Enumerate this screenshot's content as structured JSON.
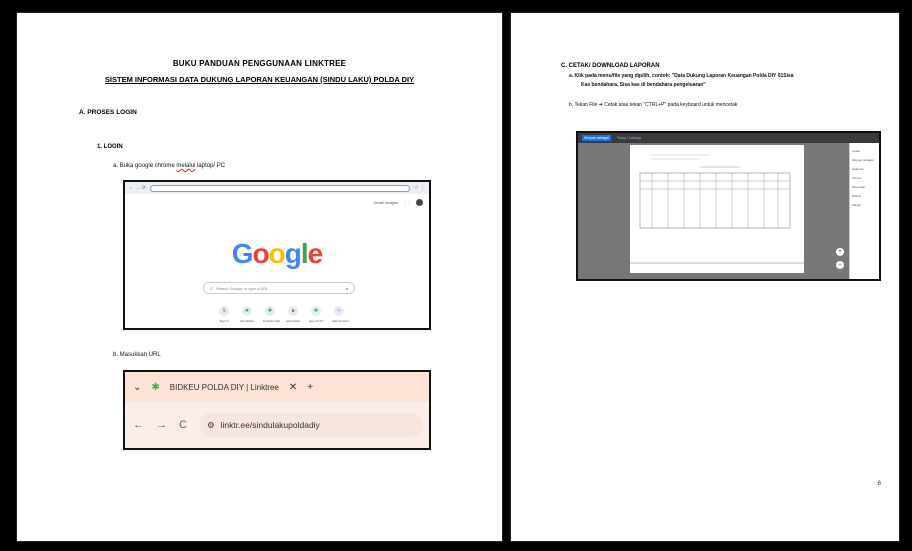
{
  "left": {
    "title1": "BUKU PANDUAN PENGGUNAAN LINKTREE",
    "title2": "SISTEM INFORMASI DATA DUKUNG LAPORAN KEUANGAN (SINDU LAKU) POLDA DIY",
    "sectionA": "A.   PROSES LOGIN",
    "sub1": "1.   LOGIN",
    "stepA_pre": "a.   Buka google chrome ",
    "stepA_sq": "melalui",
    "stepA_post": " laptop/ PC",
    "stepB": "b.   Masukkan URL"
  },
  "google_shot": {
    "top_links": "Gmail   Images",
    "logo": "Google",
    "search_placeholder": "Search Google or type a URL",
    "shortcuts": [
      "Sign in",
      "Shortlinks",
      "Portfolio Part",
      "web Sales",
      "app.LIS PJ",
      "Add shortcut"
    ]
  },
  "url_shot": {
    "tab_title": "BIDKEU POLDA DIY | Linktree",
    "url": "linktr.ee/sindulakupoldadiy"
  },
  "right": {
    "sectionC": "C.   CETAK/ DOWNLOAD LAPORAN",
    "stepA_line1": "a.   Klik pada menu/file yang dipilih, contoh: \"Data Dukung Laporan Keuangan Polda DIY 01Sisa",
    "stepA_line2": "Kas bendahara, Sisa kas di bendahara pengeluaran\"",
    "stepB": "b.   Tekan File ➜ Cetak atau tekan \"CTRL+P\" pada keyboard untuk mencetak",
    "print_btn": "Simpan sebagai",
    "print_tab": "Tutup / Lainnya",
    "side_lines": [
      "Cetak",
      "Simpan sebagai",
      "Halaman",
      "Ukuran",
      "Tata letak",
      "Warna",
      "Margin"
    ],
    "page_number": "6"
  },
  "colors": {
    "google_blue": "#4285F4",
    "google_red": "#EA4335",
    "google_yellow": "#FBBC05",
    "google_green": "#34A853",
    "url_bg": "#FDE3D6",
    "linktree_green": "#3CB34A"
  }
}
